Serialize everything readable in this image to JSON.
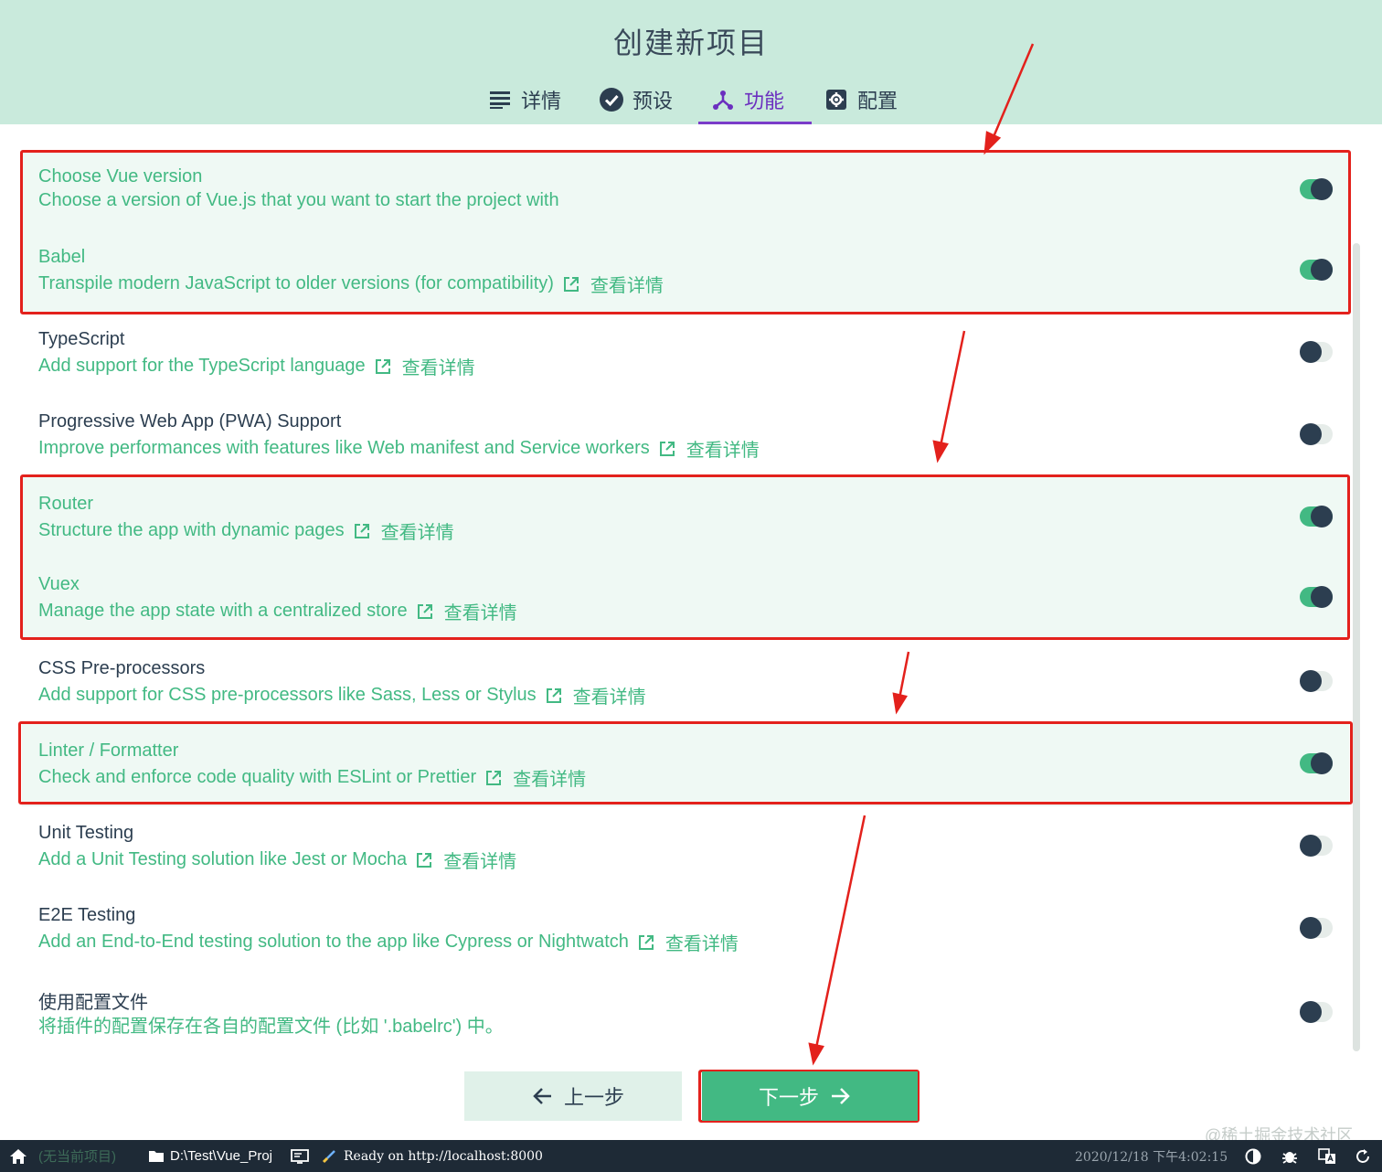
{
  "header": {
    "title": "创建新项目",
    "tabs": [
      {
        "label": "详情",
        "icon": "list-icon"
      },
      {
        "label": "预设",
        "icon": "check-circle-icon"
      },
      {
        "label": "功能",
        "icon": "fork-icon",
        "active": true
      },
      {
        "label": "配置",
        "icon": "gear-box-icon"
      }
    ]
  },
  "features": [
    {
      "name": "Choose Vue version",
      "desc": "Choose a version of Vue.js that you want to start the project with",
      "more": "",
      "enabled": true
    },
    {
      "name": "Babel",
      "desc": "Transpile modern JavaScript to older versions (for compatibility)",
      "more": "查看详情",
      "enabled": true
    },
    {
      "name": "TypeScript",
      "desc": "Add support for the TypeScript language",
      "more": "查看详情",
      "enabled": false
    },
    {
      "name": "Progressive Web App (PWA) Support",
      "desc": "Improve performances with features like Web manifest and Service workers",
      "more": "查看详情",
      "enabled": false
    },
    {
      "name": "Router",
      "desc": "Structure the app with dynamic pages",
      "more": "查看详情",
      "enabled": true
    },
    {
      "name": "Vuex",
      "desc": "Manage the app state with a centralized store",
      "more": "查看详情",
      "enabled": true
    },
    {
      "name": "CSS Pre-processors",
      "desc": "Add support for CSS pre-processors like Sass, Less or Stylus",
      "more": "查看详情",
      "enabled": false
    },
    {
      "name": "Linter / Formatter",
      "desc": "Check and enforce code quality with ESLint or Prettier",
      "more": "查看详情",
      "enabled": true
    },
    {
      "name": "Unit Testing",
      "desc": "Add a Unit Testing solution like Jest or Mocha",
      "more": "查看详情",
      "enabled": false
    },
    {
      "name": "E2E Testing",
      "desc": "Add an End-to-End testing solution to the app like Cypress or Nightwatch",
      "more": "查看详情",
      "enabled": false
    },
    {
      "name": "使用配置文件",
      "desc": "将插件的配置保存在各自的配置文件 (比如 '.babelrc') 中。",
      "more": "",
      "enabled": false
    }
  ],
  "buttons": {
    "prev": "上一步",
    "next": "下一步"
  },
  "statusbar": {
    "project": "(无当前项目)",
    "path": "D:\\Test\\Vue_Proj",
    "status": "Ready on http://localhost:8000",
    "datetime": "2020/12/18 下午4:02:15"
  },
  "watermark": "@稀土掘金技术社区",
  "colors": {
    "accent": "#42b983",
    "header_bg": "#c9eadc",
    "active_tab": "#6b2fbf",
    "highlight": "#e3211c",
    "statusbar_bg": "#1e2a36"
  }
}
